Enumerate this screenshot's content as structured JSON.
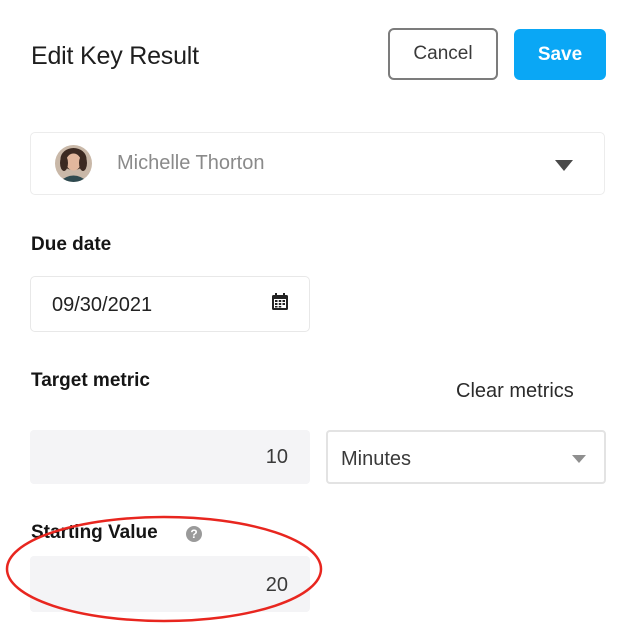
{
  "header": {
    "title": "Edit Key Result",
    "cancel_label": "Cancel",
    "save_label": "Save"
  },
  "owner": {
    "name": "Michelle Thorton",
    "avatar_icon": "user-avatar"
  },
  "due_date": {
    "label": "Due date",
    "value": "09/30/2021",
    "icon": "calendar-icon"
  },
  "target_metric": {
    "label": "Target metric",
    "clear_label": "Clear metrics",
    "value": "10",
    "unit": "Minutes"
  },
  "starting_value": {
    "label": "Starting Value",
    "help_icon_text": "?",
    "value": "20"
  },
  "colors": {
    "accent": "#0AA7F5",
    "highlight_ring": "#E8261F"
  }
}
